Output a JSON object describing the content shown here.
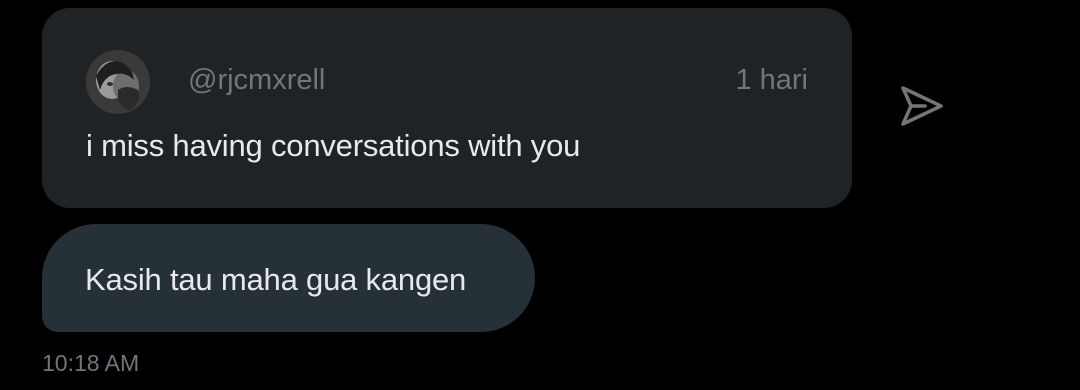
{
  "shared_tweet": {
    "handle": "@rjcmxrell",
    "time_ago": "1 hari",
    "text": "i miss having conversations with you",
    "avatar": "profile-photo"
  },
  "share_action": {
    "icon": "send-icon"
  },
  "message": {
    "text": "Kasih tau maha gua kangen",
    "time": "10:18 AM"
  },
  "colors": {
    "background": "#000000",
    "card": "#1f2326",
    "bubble": "#263037",
    "text_primary": "#e7e9ea",
    "text_secondary": "#71767b"
  }
}
